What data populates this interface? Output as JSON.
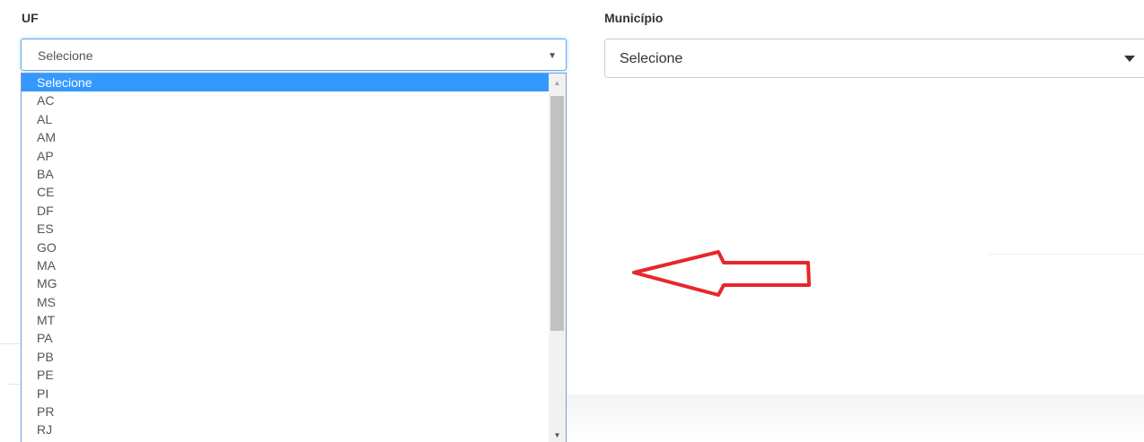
{
  "uf": {
    "label": "UF",
    "selected_value": "Selecione",
    "options": [
      "Selecione",
      "AC",
      "AL",
      "AM",
      "AP",
      "BA",
      "CE",
      "DF",
      "ES",
      "GO",
      "MA",
      "MG",
      "MS",
      "MT",
      "PA",
      "PB",
      "PE",
      "PI",
      "PR",
      "RJ"
    ],
    "selected_index": 0
  },
  "municipio": {
    "label": "Município",
    "selected_value": "Selecione"
  },
  "colors": {
    "highlight": "#3399ff",
    "arrow": "#e8262b",
    "focus_border": "#66afe9"
  },
  "icons": {
    "uf_caret": "▼",
    "scroll_up": "▲",
    "scroll_down": "▼"
  }
}
